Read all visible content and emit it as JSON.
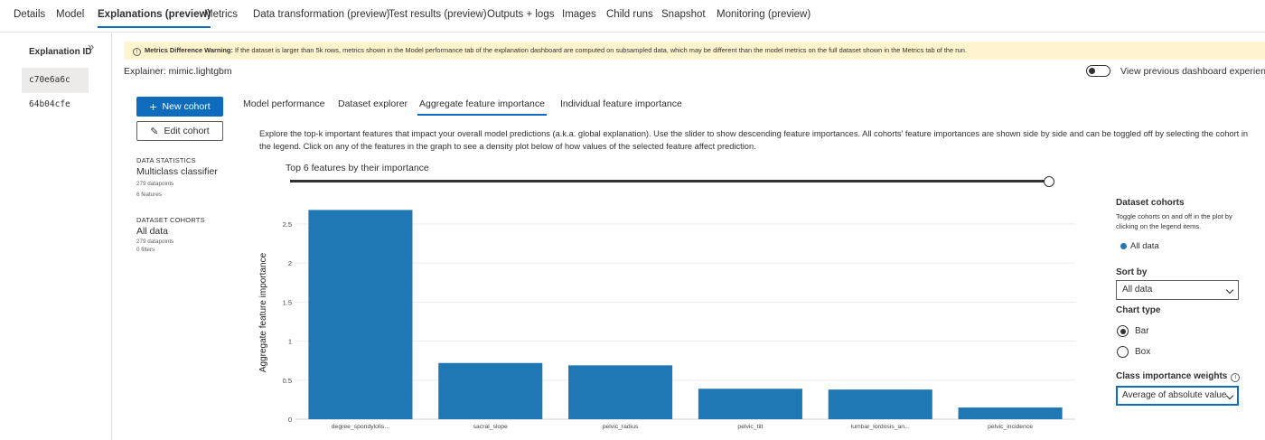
{
  "tabs": [
    "Details",
    "Model",
    "Explanations (preview)",
    "Metrics",
    "Data transformation (preview)",
    "Test results (preview)",
    "Outputs + logs",
    "Images",
    "Child runs",
    "Snapshot",
    "Monitoring (preview)"
  ],
  "active_tab": "Explanations (preview)",
  "explanation_panel": {
    "title": "Explanation ID",
    "ids": [
      "c70e6a6c",
      "64b04cfe"
    ],
    "selected": "c70e6a6c"
  },
  "warning": {
    "bold": "Metrics Difference Warning:",
    "text": " If the dataset is larger than 5k rows, metrics shown in the Model performance tab of the explanation dashboard are computed on subsampled data, which may be different than the model metrics on the full dataset shown in the Metrics tab of the run."
  },
  "explainer": "Explainer:  mimic.lightgbm",
  "view_previous_label": "View previous dashboard experience",
  "cohort_buttons": {
    "new_cohort": "New cohort",
    "edit_cohort": "Edit cohort"
  },
  "data_statistics": {
    "heading": "DATA STATISTICS",
    "classifier": "Multiclass classifier",
    "datapoints": "279 datapoints",
    "features": "6 features"
  },
  "dataset_cohorts": {
    "heading": "DATASET COHORTS",
    "name": "All data",
    "datapoints": "279 datapoints",
    "filters": "0 filters"
  },
  "subtabs": [
    "Model performance",
    "Dataset explorer",
    "Aggregate feature importance",
    "Individual feature importance"
  ],
  "active_subtab": "Aggregate feature importance",
  "description": "Explore the top-k important features that impact your overall model predictions (a.k.a. global explanation). Use the slider to show descending feature importances. All cohorts' feature importances are shown side by side and can be toggled off by selecting the cohort in the legend. Click on any of the features in the graph to see a density plot below of how values of the selected feature affect prediction.",
  "slider": {
    "label": "Top 6 features by their importance",
    "value": 6,
    "max": 6
  },
  "chart_data": {
    "type": "bar",
    "categories": [
      "degree_spondylolis...",
      "sacral_slope",
      "pelvic_radius",
      "pelvic_tilt",
      "lumbar_lordosis_an...",
      "pelvic_incidence"
    ],
    "series": [
      {
        "name": "All data",
        "values": [
          2.68,
          0.72,
          0.69,
          0.39,
          0.38,
          0.15
        ]
      }
    ],
    "ylabel": "Aggregate feature importance",
    "ylim": [
      0,
      2.8
    ],
    "yticks": [
      0,
      0.5,
      1,
      1.5,
      2,
      2.5
    ],
    "ytick_labels": [
      "0",
      "0.5",
      "1",
      "1.5",
      "2",
      "2.5"
    ],
    "grid": true,
    "color": "#1f77b4"
  },
  "options_panel": {
    "cohorts_heading": "Dataset cohorts",
    "cohorts_hint": "Toggle cohorts on and off in the plot by clicking on the legend items.",
    "legend_item": "All data",
    "sort_by_label": "Sort by",
    "sort_by_value": "All data",
    "chart_type_label": "Chart type",
    "chart_type_options": [
      "Bar",
      "Box"
    ],
    "chart_type_selected": "Bar",
    "class_weights_label": "Class importance weights",
    "class_weights_value": "Average of absolute value"
  }
}
